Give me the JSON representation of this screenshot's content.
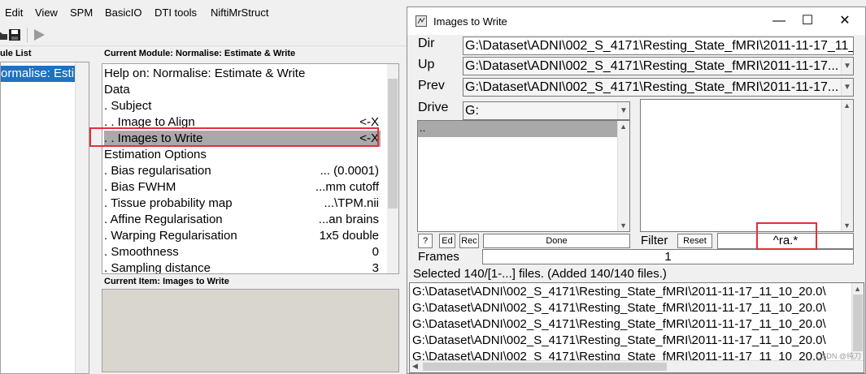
{
  "menubar": {
    "items": [
      "Edit",
      "View",
      "SPM",
      "BasicIO",
      "DTI tools",
      "NiftiMrStruct"
    ]
  },
  "module_list": {
    "title": "ule List",
    "selected": "ormalise: Estim"
  },
  "current_module": {
    "title": "Current Module: Normalise: Estimate & Write",
    "rows": [
      {
        "label": "Help on: Normalise: Estimate & Write",
        "value": ""
      },
      {
        "label": "Data",
        "value": ""
      },
      {
        "label": ". Subject",
        "value": ""
      },
      {
        "label": ". . Image to Align",
        "value": "<-X"
      },
      {
        "label": ". . Images to Write",
        "value": "<-X"
      },
      {
        "label": "Estimation Options",
        "value": ""
      },
      {
        "label": ". Bias regularisation",
        "value": "... (0.0001)"
      },
      {
        "label": ". Bias FWHM",
        "value": "...mm cutoff"
      },
      {
        "label": ". Tissue probability map",
        "value": "...\\TPM.nii"
      },
      {
        "label": ". Affine Regularisation",
        "value": "...an brains"
      },
      {
        "label": ". Warping Regularisation",
        "value": "1x5 double"
      },
      {
        "label": ". Smoothness",
        "value": "0"
      },
      {
        "label": ". Sampling distance",
        "value": "3"
      }
    ]
  },
  "current_item": {
    "title": "Current Item: Images to Write"
  },
  "dialog": {
    "title": "Images to Write",
    "minimize": "—",
    "maximize": "☐",
    "close": "✕",
    "dir_label": "Dir",
    "dir_value": "G:\\Dataset\\ADNI\\002_S_4171\\Resting_State_fMRI\\2011-11-17_11_",
    "up_label": "Up",
    "up_value": "G:\\Dataset\\ADNI\\002_S_4171\\Resting_State_fMRI\\2011-11-17...",
    "prev_label": "Prev",
    "prev_value": "G:\\Dataset\\ADNI\\002_S_4171\\Resting_State_fMRI\\2011-11-17...",
    "drive_label": "Drive",
    "drive_value": "G:",
    "dir_list": [
      ".."
    ],
    "btn_help": "?",
    "btn_ed": "Ed",
    "btn_rec": "Rec",
    "btn_done": "Done",
    "filter_label": "Filter",
    "btn_reset": "Reset",
    "filter_value": "^ra.*",
    "frames_label": "Frames",
    "frames_value": "1",
    "status": "Selected 140/[1-...] files. (Added 140/140 files.)",
    "selected_files": [
      "G:\\Dataset\\ADNI\\002_S_4171\\Resting_State_fMRI\\2011-11-17_11_10_20.0\\",
      "G:\\Dataset\\ADNI\\002_S_4171\\Resting_State_fMRI\\2011-11-17_11_10_20.0\\",
      "G:\\Dataset\\ADNI\\002_S_4171\\Resting_State_fMRI\\2011-11-17_11_10_20.0\\",
      "G:\\Dataset\\ADNI\\002_S_4171\\Resting_State_fMRI\\2011-11-17_11_10_20.0\\",
      "G:\\Dataset\\ADNI\\002_S_4171\\Resting_State_fMRI\\2011-11-17_11_10_20.0\\"
    ]
  },
  "watermark": "CSDN @纯刀",
  "colors": {
    "selection_blue": "#1f71c3",
    "highlight_red": "#e0303a",
    "row_selected_gray": "#a9a9a9"
  }
}
